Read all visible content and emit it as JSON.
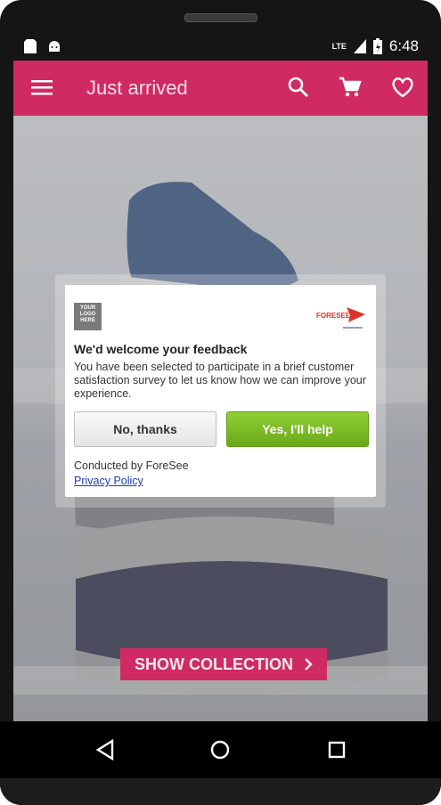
{
  "status": {
    "time": "6:48",
    "network": "LTE"
  },
  "appbar": {
    "title": "Just arrived",
    "icons": [
      "menu-icon",
      "search-icon",
      "cart-icon",
      "heart-icon"
    ]
  },
  "dialog": {
    "logo_text": "YOUR LOGO HERE",
    "brand": "FORESEE",
    "title": "We'd welcome your feedback",
    "body": "You have been selected to participate in a brief customer satisfaction survey to let us know how we can improve your experience.",
    "no_label": "No, thanks",
    "yes_label": "Yes, I'll help",
    "conducted": "Conducted by ForeSee",
    "privacy": "Privacy Policy"
  },
  "collection": {
    "button_label": "SHOW COLLECTION"
  },
  "colors": {
    "primary": "#cf2b62",
    "yes_green": "#7bbd24"
  },
  "navbar": {
    "icons": [
      "back-icon",
      "home-icon",
      "recents-icon"
    ]
  }
}
